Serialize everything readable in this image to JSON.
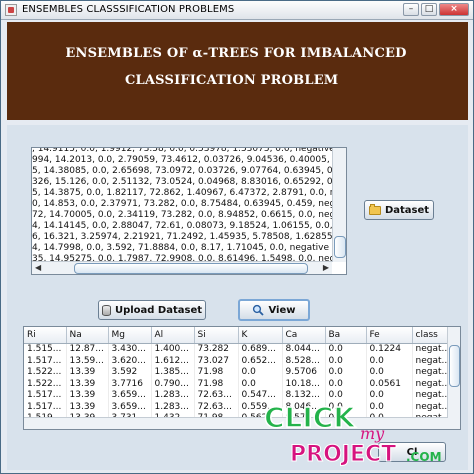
{
  "window": {
    "title": "ENSEMBLES CLASSSIFICATION PROBLEMS",
    "controls": {
      "minimize": "–",
      "maximize": "□",
      "close": "×"
    }
  },
  "header": {
    "line1": "ENSEMBLES OF α-TREES FOR IMBALANCED",
    "line2": "CLASSIFICATION PROBLEM"
  },
  "dataset_text": {
    "lines": [
      ", 14.9115, 0.0, 1.9912, 73.58, 0.0, 0.53978, 1.53075, 0.0, negative",
      "994, 14.2013, 0.0, 2.79059, 73.4612, 0.03726, 9.04536, 0.40005, 0.459,",
      "5, 14.38085, 0.0, 2.65698, 73.0972, 0.03726, 9.07764, 0.63945, 0.0, ne",
      "326, 15.126, 0.0, 2.51132, 73.0524, 0.04968, 8.83016, 0.65292, 0.0, ne",
      "5, 14.3875, 0.0, 1.82117, 72.862, 1.40967, 6.47372, 2.8791, 0.0, nega",
      "0, 14.853, 0.0, 2.37971, 73.282, 0.0, 8.75484, 0.63945, 0.459, negativ",
      "72, 14.70005, 0.0, 2.34119, 73.282, 0.0, 8.94852, 0.6615, 0.0, negative",
      "4, 14.14145, 0.0, 2.88047, 72.61, 0.08073, 9.18524, 1.06155, 0.0, ne",
      "6, 16.321, 3.25974, 2.21921, 71.2492, 1.45935, 5.78508, 1.62855, 0.0",
      "4, 14.7998, 0.0, 3.592, 71.8884, 0.0, 8.17, 1.71045, 0.0, negative",
      "35, 14.95275, 0.0, 1.7987, 72.9908, 0.0, 8.61496, 1.5498, 0.0, negativ"
    ],
    "scroll_left_arrow": "◀",
    "scroll_right_arrow": "▶"
  },
  "buttons": {
    "dataset": "Dataset",
    "upload_dataset": "Upload Dataset",
    "view": "View",
    "bottom": "Cl"
  },
  "table": {
    "columns": [
      "Ri",
      "Na",
      "Mg",
      "Al",
      "Si",
      "K",
      "Ca",
      "Ba",
      "Fe",
      "class"
    ],
    "rows": [
      [
        "1.515...",
        "12.87...",
        "3.430...",
        "1.400...",
        "73.282",
        "0.689...",
        "8.044...",
        "0.0",
        "0.1224",
        "negat..."
      ],
      [
        "1.517...",
        "13.59...",
        "3.620...",
        "1.612...",
        "73.027",
        "0.652...",
        "8.528...",
        "0.0",
        "0.0",
        "negat..."
      ],
      [
        "1.522...",
        "13.39",
        "3.592",
        "1.385...",
        "71.98",
        "0.0",
        "9.5706",
        "0.0",
        "0.0",
        "negat..."
      ],
      [
        "1.522...",
        "13.39",
        "3.7716",
        "0.790...",
        "71.98",
        "0.0",
        "10.18...",
        "0.0",
        "0.0561",
        "negat..."
      ],
      [
        "1.517...",
        "13.39",
        "3.659...",
        "1.283...",
        "72.63...",
        "0.547...",
        "8.132...",
        "0.0",
        "0.0",
        "negat..."
      ],
      [
        "1.517...",
        "13.39",
        "3.659...",
        "1.283...",
        "72.63...",
        "0.559...",
        "8.046...",
        "0.0",
        "0.0",
        "negat..."
      ],
      [
        "1.519...",
        "13.39",
        "3.731",
        "1.432...",
        "71.98",
        "0.562...",
        "8.573...",
        "0.0",
        "0.0",
        "negat..."
      ]
    ]
  },
  "watermark": {
    "word1": "CLICK",
    "word2": "my",
    "word3": "PROJECT",
    "domain": ".COM",
    "colors": {
      "green": "#24b34b",
      "magenta": "#d6137f"
    }
  }
}
